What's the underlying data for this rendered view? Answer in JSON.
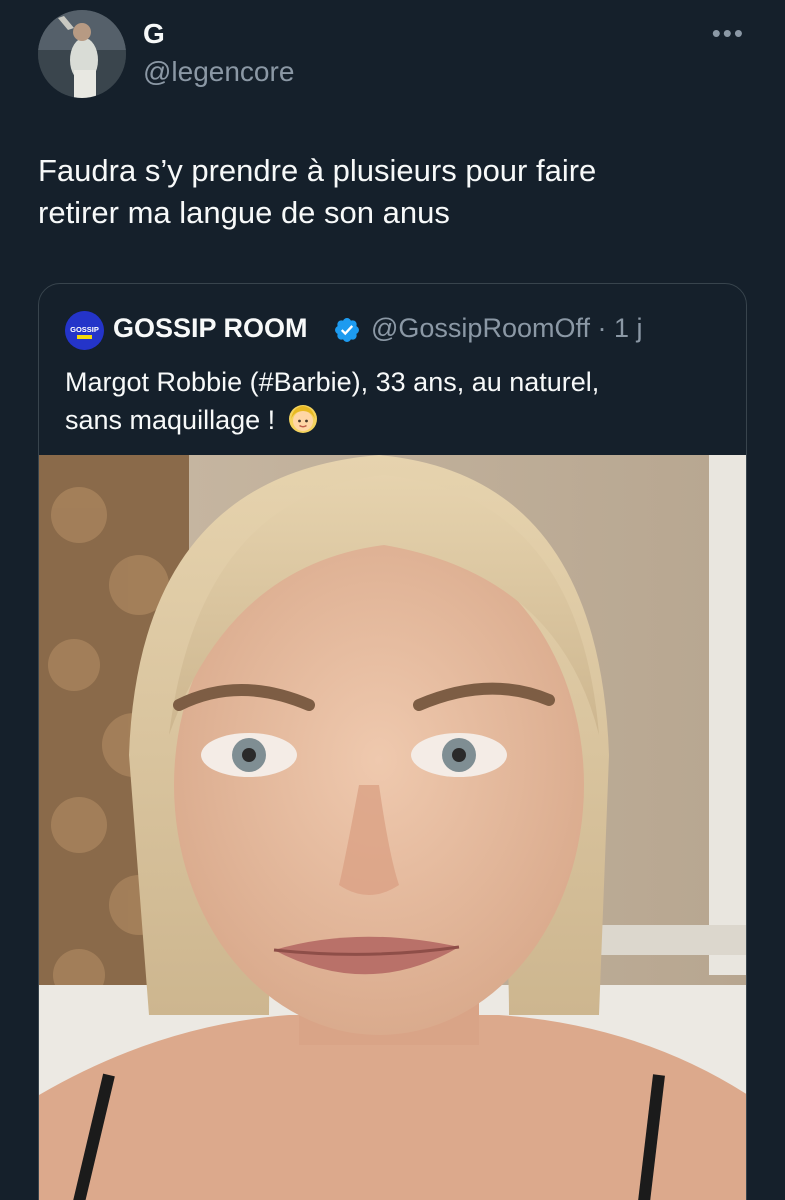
{
  "author": {
    "display_name": "G",
    "handle": "@legencore"
  },
  "more_icon": "more-options-icon",
  "tweet_text_lines": [
    "Faudra s’y prendre à plusieurs pour faire",
    "retirer ma langue de son anus"
  ],
  "quoted": {
    "avatar_text": "GOSSIP",
    "display_name": "GOSSIP ROOM",
    "verified": true,
    "handle_time": "@GossipRoomOff · 1 j",
    "text_lines": [
      "Margot Robbie (#Barbie), 33 ans, au naturel,",
      "sans maquillage !"
    ],
    "emoji": "woman-blond-hair-emoji",
    "image": "photo-woman-selfie"
  },
  "colors": {
    "background": "#15202b",
    "text": "#f7f9f9",
    "secondary_text": "#8b98a5",
    "border": "#38444d",
    "verified": "#1d9bf0"
  }
}
